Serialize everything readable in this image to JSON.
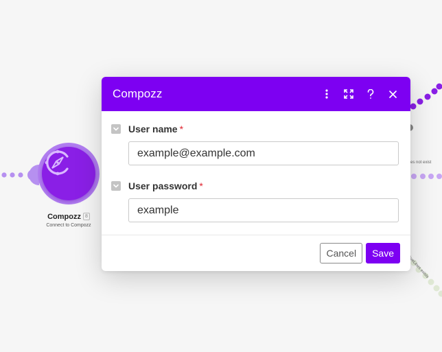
{
  "dialog": {
    "title": "Compozz",
    "fields": [
      {
        "label": "User name",
        "required_mark": "*",
        "value": "example@example.com"
      },
      {
        "label": "User password",
        "required_mark": "*",
        "value": "example"
      }
    ],
    "cancel_label": "Cancel",
    "save_label": "Save"
  },
  "canvas": {
    "node": {
      "name": "Compozz",
      "badge": "8",
      "subtitle": "Connect to Compozz"
    },
    "route_labels": [
      "es not exist",
      "- TrueLines exists"
    ]
  },
  "colors": {
    "accent": "#7d00f2",
    "node_fill": "#8a1fe6",
    "node_ring": "#b17ef0",
    "required": "#e0242f"
  },
  "icons": {
    "node": "compass-icon",
    "header": [
      "more-vertical-icon",
      "expand-icon",
      "help-icon",
      "close-icon"
    ],
    "field_toggle": "chevron-down-icon"
  }
}
